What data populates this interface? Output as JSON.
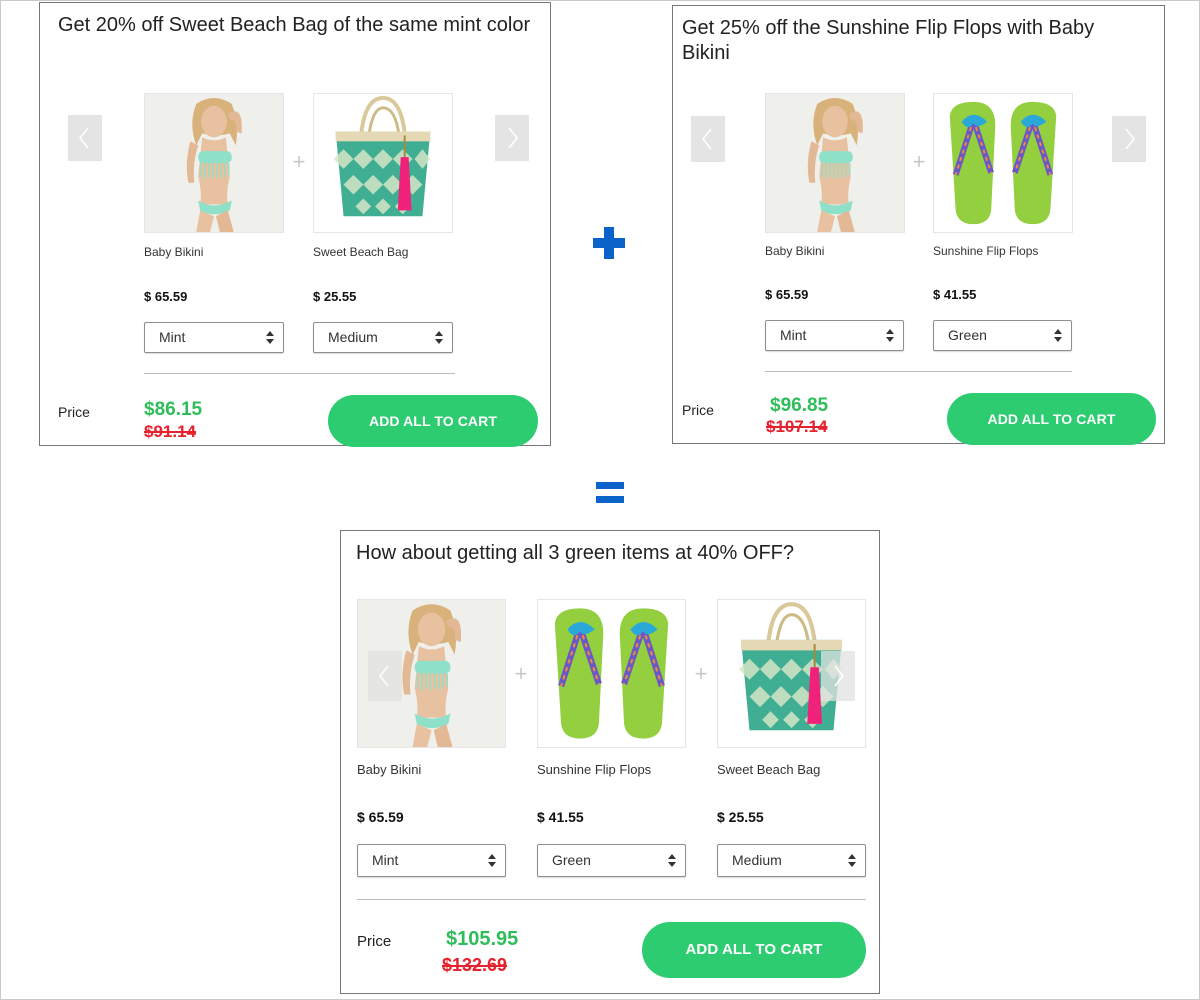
{
  "bundles": {
    "beach_bag": {
      "title": "Get 20% off Sweet Beach Bag of the same mint color",
      "items": [
        {
          "name": "Baby Bikini",
          "price": "$ 65.59",
          "option": "Mint",
          "image": "bikini-photo"
        },
        {
          "name": "Sweet Beach Bag",
          "price": "$ 25.55",
          "option": "Medium",
          "image": "beach-bag-photo"
        }
      ],
      "price_label": "Price",
      "new_price": "$86.15",
      "old_price": "$91.14",
      "button": "ADD ALL TO CART"
    },
    "flip_flops": {
      "title": "Get 25% off the Sunshine Flip Flops with Baby Bikini",
      "items": [
        {
          "name": "Baby Bikini",
          "price": "$ 65.59",
          "option": "Mint",
          "image": "bikini-photo"
        },
        {
          "name": "Sunshine Flip Flops",
          "price": "$ 41.55",
          "option": "Green",
          "image": "flip-flops-photo"
        }
      ],
      "price_label": "Price",
      "new_price": "$96.85",
      "old_price": "$107.14",
      "button": "ADD ALL TO CART"
    },
    "combo": {
      "title": "How about getting all 3 green items at 40% OFF?",
      "items": [
        {
          "name": "Baby Bikini",
          "price": "$ 65.59",
          "option": "Mint",
          "image": "bikini-photo"
        },
        {
          "name": "Sunshine Flip Flops",
          "price": "$ 41.55",
          "option": "Green",
          "image": "flip-flops-photo"
        },
        {
          "name": "Sweet Beach Bag",
          "price": "$ 25.55",
          "option": "Medium",
          "image": "beach-bag-photo"
        }
      ],
      "price_label": "Price",
      "new_price": "$105.95",
      "old_price": "$132.69",
      "button": "ADD ALL TO CART"
    }
  },
  "operators": {
    "plus": "plus-icon",
    "equals": "equals-icon"
  },
  "colors": {
    "accent_blue": "#0a63c9",
    "button_green": "#2ecc71",
    "new_price_green": "#2ebd59",
    "old_price_red": "#e6222e"
  }
}
